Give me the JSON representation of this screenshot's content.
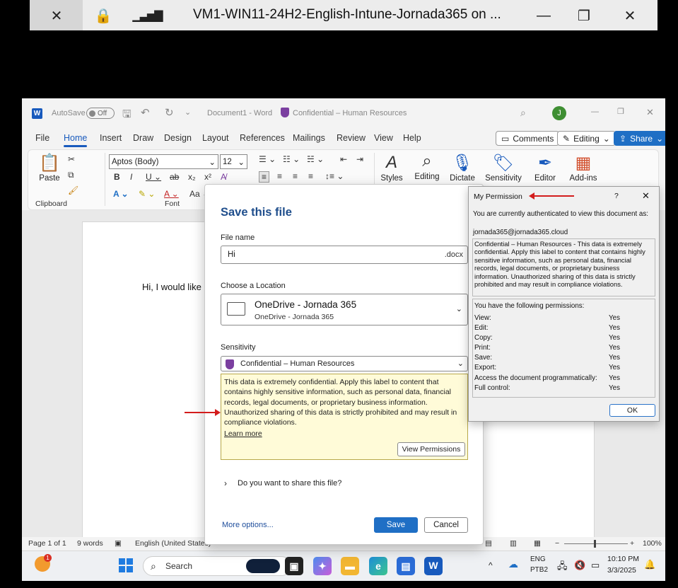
{
  "remote_bar": {
    "title": "VM1-WIN11-24H2-English-Intune-Jornada365 on ...",
    "icons": [
      "pin-off-icon",
      "lock-icon",
      "signal-icon",
      "minimize-icon",
      "restore-icon",
      "close-icon"
    ]
  },
  "word": {
    "autosave_label": "AutoSave",
    "autosave_state": "Off",
    "doc_title": "Document1 - Word",
    "sensitivity_label": "Confidential – Human Resources",
    "avatar_initial": "J",
    "tabs": [
      "File",
      "Home",
      "Insert",
      "Draw",
      "Design",
      "Layout",
      "References",
      "Mailings",
      "Review",
      "View",
      "Help"
    ],
    "active_tab": "Home",
    "comments_label": "Comments",
    "editing_label": "Editing",
    "share_label": "Share",
    "font_name": "Aptos (Body)",
    "font_size": "12",
    "paste_label": "Paste",
    "clipboard_group": "Clipboard",
    "font_group": "Font",
    "styles_label": "Styles",
    "editing_tool_label": "Editing",
    "dictate_label": "Dictate",
    "sensitivity_tool_label": "Sensitivity",
    "editor_label": "Editor",
    "addins_label": "Add-ins",
    "doc_text": "Hi, I would like"
  },
  "status_bar": {
    "page": "Page 1 of 1",
    "words": "9 words",
    "language": "English (United States)",
    "zoom": "100%"
  },
  "taskbar": {
    "search_placeholder": "Search",
    "badge_count": "1",
    "lang_top": "ENG",
    "lang_bottom": "PTB2",
    "time": "10:10 PM",
    "date": "3/3/2025"
  },
  "save_dialog": {
    "title": "Save this file",
    "file_name_label": "File name",
    "file_name_value": "Hi",
    "extension": ".docx",
    "location_label": "Choose a Location",
    "location_name": "OneDrive - Jornada 365",
    "location_sub": "OneDrive - Jornada 365",
    "sensitivity_label": "Sensitivity",
    "sensitivity_value": "Confidential – Human Resources",
    "sensitivity_description": "This data is extremely confidential. Apply this label to content that contains highly sensitive information, such as personal data, financial records, legal documents, or proprietary business information. Unauthorized sharing of this data is strictly prohibited and may result in compliance violations.",
    "learn_more": "Learn more",
    "view_permissions": "View Permissions",
    "share_question": "Do you want to share this file?",
    "more_options": "More options...",
    "save_button": "Save",
    "cancel_button": "Cancel"
  },
  "permission_dialog": {
    "title": "My Permission",
    "help": "?",
    "auth_text": "You are currently authenticated to view this document as:",
    "account": "jornada365@jornada365.cloud",
    "label_text": "Confidential – Human Resources - This data is extremely confidential. Apply this label to content that contains highly sensitive information, such as personal data, financial records, legal documents, or proprietary business information. Unauthorized sharing of this data is strictly prohibited and may result in compliance violations.",
    "permissions_header": "You have the following permissions:",
    "permissions": [
      {
        "name": "View:",
        "value": "Yes"
      },
      {
        "name": "Edit:",
        "value": "Yes"
      },
      {
        "name": "Copy:",
        "value": "Yes"
      },
      {
        "name": "Print:",
        "value": "Yes"
      },
      {
        "name": "Save:",
        "value": "Yes"
      },
      {
        "name": "Export:",
        "value": "Yes"
      },
      {
        "name": "Access the document programmatically:",
        "value": "Yes"
      },
      {
        "name": "Full control:",
        "value": "Yes"
      }
    ],
    "ok_button": "OK"
  },
  "colors": {
    "accent": "#1f6fc5",
    "word_blue": "#185abd",
    "note_bg": "#fffbd8",
    "arrow_red": "#d31c1c"
  }
}
